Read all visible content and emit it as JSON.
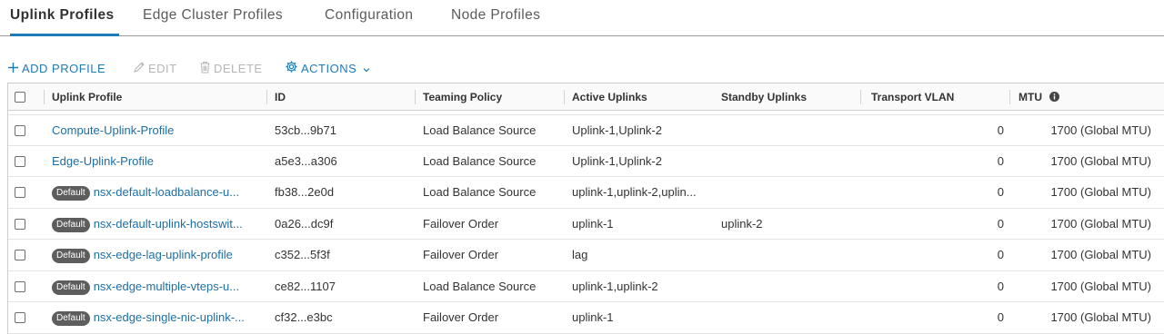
{
  "tabs": [
    {
      "label": "Uplink Profiles",
      "active": true
    },
    {
      "label": "Edge Cluster Profiles",
      "active": false
    },
    {
      "label": "Configuration",
      "active": false
    },
    {
      "label": "Node Profiles",
      "active": false
    }
  ],
  "toolbar": {
    "add_label": "ADD PROFILE",
    "edit_label": "EDIT",
    "delete_label": "DELETE",
    "actions_label": "ACTIONS"
  },
  "table": {
    "columns": [
      "Uplink Profile",
      "ID",
      "Teaming Policy",
      "Active Uplinks",
      "Standby Uplinks",
      "Transport VLAN",
      "MTU"
    ],
    "default_badge": "Default",
    "rows": [
      {
        "name": "Compute-Uplink-Profile",
        "default": false,
        "id": "53cb...9b71",
        "teaming": "Load Balance Source",
        "active": "Uplink-1,Uplink-2",
        "standby": "",
        "vlan": "0",
        "mtu": "1700 (Global MTU)"
      },
      {
        "name": "Edge-Uplink-Profile",
        "default": false,
        "id": "a5e3...a306",
        "teaming": "Load Balance Source",
        "active": "Uplink-1,Uplink-2",
        "standby": "",
        "vlan": "0",
        "mtu": "1700 (Global MTU)"
      },
      {
        "name": "nsx-default-loadbalance-u...",
        "default": true,
        "id": "fb38...2e0d",
        "teaming": "Load Balance Source",
        "active": "uplink-1,uplink-2,uplin...",
        "standby": "",
        "vlan": "0",
        "mtu": "1700 (Global MTU)"
      },
      {
        "name": "nsx-default-uplink-hostswit...",
        "default": true,
        "id": "0a26...dc9f",
        "teaming": "Failover Order",
        "active": "uplink-1",
        "standby": "uplink-2",
        "vlan": "0",
        "mtu": "1700 (Global MTU)"
      },
      {
        "name": "nsx-edge-lag-uplink-profile",
        "default": true,
        "id": "c352...5f3f",
        "teaming": "Failover Order",
        "active": "lag",
        "standby": "",
        "vlan": "0",
        "mtu": "1700 (Global MTU)"
      },
      {
        "name": "nsx-edge-multiple-vteps-u...",
        "default": true,
        "id": "ce82...1107",
        "teaming": "Load Balance Source",
        "active": "uplink-1,uplink-2",
        "standby": "",
        "vlan": "0",
        "mtu": "1700 (Global MTU)"
      },
      {
        "name": "nsx-edge-single-nic-uplink-...",
        "default": true,
        "id": "cf32...e3bc",
        "teaming": "Failover Order",
        "active": "uplink-1",
        "standby": "",
        "vlan": "0",
        "mtu": "1700 (Global MTU)"
      }
    ]
  },
  "icons": {
    "add": "plus-icon",
    "edit": "pencil-icon",
    "delete": "trash-icon",
    "actions": "gear-icon",
    "actions_menu": "chevron-down-icon",
    "mtu_info": "info-icon"
  },
  "colors": {
    "accent": "#1d7bb8",
    "link": "#1d6fa5",
    "disabled": "#b6b6b6",
    "badge": "#5d5d5d"
  }
}
